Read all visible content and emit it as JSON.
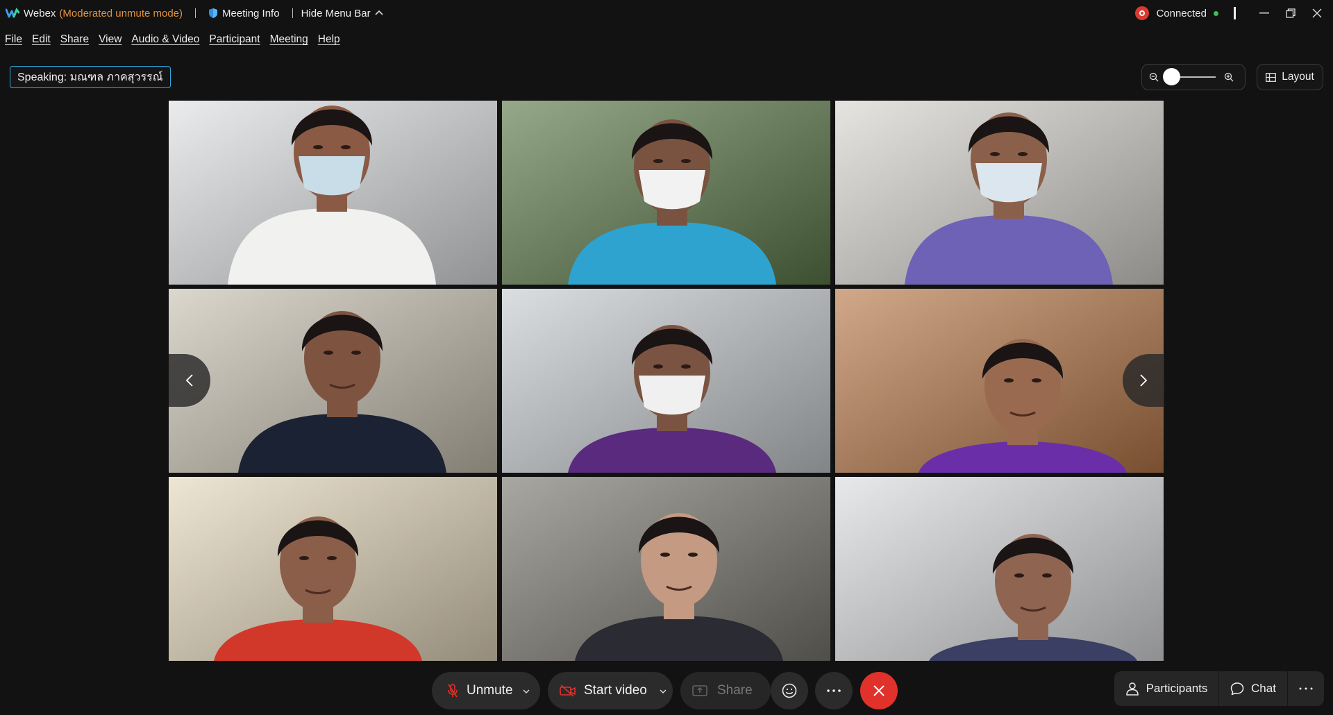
{
  "titlebar": {
    "app_name": "Webex",
    "mode": "(Moderated unmute mode)",
    "meeting_info": "Meeting Info",
    "hide_menu_bar": "Hide Menu Bar",
    "status": "Connected",
    "icons": [
      "webex-logo-icon",
      "shield-icon",
      "chevron-up-icon",
      "recording-icon",
      "minimize-icon",
      "restore-icon",
      "close-icon"
    ]
  },
  "menu": [
    "File",
    "Edit",
    "Share",
    "View",
    "Audio & Video",
    "Participant",
    "Meeting",
    "Help"
  ],
  "speaking": "Speaking: มณฑล ภาคสุวรรณ์",
  "zoom": {
    "level": 0.0
  },
  "layout_label": "Layout",
  "participants_grid": [
    {
      "id": 1,
      "bg": "#dfe1e3",
      "shirt": "#f1f1ef",
      "skin": "#8a5a44",
      "mask": "#c9dde8"
    },
    {
      "id": 2,
      "bg": "#5d7a4a",
      "shirt": "#2ea3cf",
      "skin": "#7a5240",
      "mask": "#f2f2f2"
    },
    {
      "id": 3,
      "bg": "#d9d6d0",
      "shirt": "#6e62b6",
      "skin": "#8a604a",
      "mask": "#dbe6ee"
    },
    {
      "id": 4,
      "bg": "#c9c2b3",
      "shirt": "#1b2233",
      "skin": "#7e5440",
      "mask": null
    },
    {
      "id": 5,
      "bg": "#c8ccd0",
      "shirt": "#5a2a7e",
      "skin": "#7a5342",
      "mask": "#f0f0f0"
    },
    {
      "id": 6,
      "bg": "#b87a4a",
      "shirt": "#6a2fa8",
      "skin": "#9a6a50",
      "mask": null
    },
    {
      "id": 7,
      "bg": "#e5d8bc",
      "shirt": "#d1382a",
      "skin": "#8a5e48",
      "mask": null
    },
    {
      "id": 8,
      "bg": "#7b786f",
      "shirt": "#2a2b33",
      "skin": "#c49a82",
      "mask": null
    },
    {
      "id": 9,
      "bg": "#dcdde0",
      "shirt": "#3b3f63",
      "skin": "#8f6552",
      "mask": null
    }
  ],
  "controls": {
    "unmute": "Unmute",
    "start_video": "Start video",
    "share": "Share",
    "participants": "Participants",
    "chat": "Chat"
  },
  "colors": {
    "accent": "#34a9e0",
    "end_call": "#e0322b",
    "recording": "#d93a32",
    "connected_dot": "#3ebf55",
    "mode_text": "#e0913f"
  }
}
